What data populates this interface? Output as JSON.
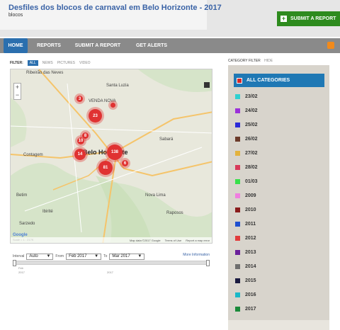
{
  "header": {
    "title": "Desfiles dos blocos de carnaval em Belo Horizonte - 2017",
    "subtitle": "blocos",
    "submit_label": "SUBMIT A REPORT"
  },
  "nav": {
    "items": [
      "HOME",
      "REPORTS",
      "SUBMIT A REPORT",
      "GET ALERTS"
    ],
    "active": "HOME"
  },
  "filter": {
    "label": "FILTER:",
    "options": [
      "ALL",
      "NEWS",
      "PICTURES",
      "VIDEO"
    ]
  },
  "map": {
    "places": [
      "Ribeirão das Neves",
      "Santa Luzia",
      "VENDA NOVA",
      "Contagem",
      "Belo Horizonte",
      "Sabará",
      "Betim",
      "Nova Lima",
      "Ibirité",
      "Raposos",
      "Sarzedo"
    ],
    "clusters": [
      "3",
      "23",
      "138",
      "81",
      "14",
      "10",
      "8",
      "6"
    ],
    "attribution": "Map data ©2017 Google",
    "terms": "Terms of Use",
    "report_error": "Report a map error",
    "scale": "Scale = 1 : 217K",
    "google": "Google"
  },
  "timeline": {
    "interval_label": "Interval",
    "interval_value": "Auto",
    "from_label": "From",
    "from_value": "Feb 2017",
    "to_label": "To",
    "to_value": "Mar 2017",
    "more_info": "More Information",
    "start_label": "Feb",
    "start_year": "2017",
    "mid_label": "2017"
  },
  "sidebar": {
    "heading": "CATEGORY FILTER",
    "heading_hide": "HIDE",
    "all_label": "ALL CATEGORIES",
    "categories": [
      {
        "label": "23/02",
        "color": "#2fd0d0"
      },
      {
        "label": "24/02",
        "color": "#9b30d9"
      },
      {
        "label": "25/02",
        "color": "#2a2ad8"
      },
      {
        "label": "26/02",
        "color": "#6b3a2a"
      },
      {
        "label": "27/02",
        "color": "#e3b23c"
      },
      {
        "label": "28/02",
        "color": "#d83a5a"
      },
      {
        "label": "01/03",
        "color": "#38e04a"
      },
      {
        "label": "2009",
        "color": "#f07ee0"
      },
      {
        "label": "2010",
        "color": "#8a1c1c"
      },
      {
        "label": "2011",
        "color": "#1f4fd0"
      },
      {
        "label": "2012",
        "color": "#e23c3c"
      },
      {
        "label": "2013",
        "color": "#6a1f9a"
      },
      {
        "label": "2014",
        "color": "#6e6e6e"
      },
      {
        "label": "2015",
        "color": "#1a1a40"
      },
      {
        "label": "2016",
        "color": "#1ab8c8"
      },
      {
        "label": "2017",
        "color": "#1a8a3a"
      }
    ]
  }
}
